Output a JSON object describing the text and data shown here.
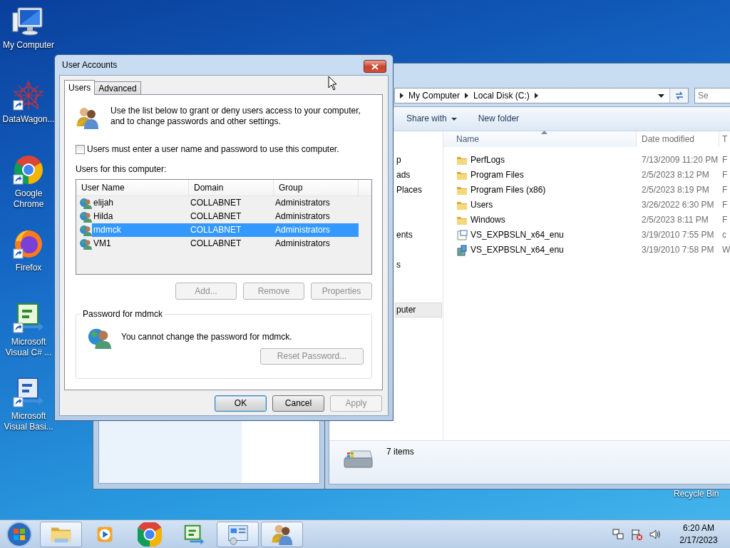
{
  "desktop": {
    "icons": [
      {
        "kind": "computer",
        "label": "My Computer",
        "shortcut": false
      },
      {
        "kind": "network-art",
        "label": "DataWagon...",
        "shortcut": true
      },
      {
        "kind": "browser",
        "label": "Google Chrome",
        "shortcut": true
      },
      {
        "kind": "firefox",
        "label": "Firefox",
        "shortcut": true
      },
      {
        "kind": "csharp",
        "label": "Microsoft Visual C# ...",
        "shortcut": true
      },
      {
        "kind": "vb",
        "label": "Microsoft Visual Basi...",
        "shortcut": true
      }
    ],
    "recycle_bin_label": "Recycle Bin"
  },
  "explorer": {
    "breadcrumb": [
      "My Computer",
      "Local Disk (C:)"
    ],
    "search": {
      "placeholder": "Se"
    },
    "toolbar": [
      {
        "label": "Share with",
        "dropdown": true
      },
      {
        "label": "New folder",
        "dropdown": false
      }
    ],
    "nav_items": [
      {
        "label": "p",
        "selected": false
      },
      {
        "label": "ads",
        "selected": false
      },
      {
        "label": "Places",
        "selected": false
      },
      {
        "label": "ents",
        "selected": false
      },
      {
        "label": "s",
        "selected": false
      },
      {
        "label": "puter",
        "selected": true
      }
    ],
    "columns": [
      {
        "label": "Name",
        "sorted": true
      },
      {
        "label": "Date modified",
        "sorted": false
      },
      {
        "label": "T",
        "sorted": false
      }
    ],
    "rows": [
      {
        "kind": "folder",
        "name": "PerfLogs",
        "date_modified": "7/13/2009 11:20 PM",
        "column_3": "F"
      },
      {
        "kind": "folder",
        "name": "Program Files",
        "date_modified": "2/5/2023 8:12 PM",
        "column_3": "F"
      },
      {
        "kind": "folder",
        "name": "Program Files (x86)",
        "date_modified": "2/5/2023 8:19 PM",
        "column_3": "F"
      },
      {
        "kind": "folder",
        "name": "Users",
        "date_modified": "3/26/2022 6:30 PM",
        "column_3": "F"
      },
      {
        "kind": "folder",
        "name": "Windows",
        "date_modified": "2/5/2023 8:11 PM",
        "column_3": "F"
      },
      {
        "kind": "setup",
        "name": "VS_EXPBSLN_x64_enu",
        "date_modified": "3/19/2010 7:55 PM",
        "column_3": "c"
      },
      {
        "kind": "installer",
        "name": "VS_EXPBSLN_x64_enu",
        "date_modified": "3/19/2010 7:58 PM",
        "column_3": "W"
      }
    ],
    "status": "7 items"
  },
  "dialog": {
    "title": "User Accounts",
    "tabs": [
      {
        "label": "Users",
        "selected": true
      },
      {
        "label": "Advanced",
        "selected": false
      }
    ],
    "intro": "Use the list below to grant or deny users access to your computer, and to change passwords and other settings.",
    "checkbox": {
      "label": "Users must enter a user name and password to use this computer.",
      "checked": false
    },
    "list_label": "Users for this computer:",
    "columns": [
      "User Name",
      "Domain",
      "Group"
    ],
    "users": [
      {
        "name": "elijah",
        "domain": "COLLABNET",
        "group": "Administrators",
        "selected": false
      },
      {
        "name": "Hilda",
        "domain": "COLLABNET",
        "group": "Administrators",
        "selected": false
      },
      {
        "name": "mdmck",
        "domain": "COLLABNET",
        "group": "Administrators",
        "selected": true
      },
      {
        "name": "VM1",
        "domain": "COLLABNET",
        "group": "Administrators",
        "selected": false
      }
    ],
    "list_buttons": [
      {
        "label": "Add...",
        "disabled": true
      },
      {
        "label": "Remove",
        "disabled": true
      },
      {
        "label": "Properties",
        "disabled": true
      }
    ],
    "password_group": {
      "title": "Password for mdmck",
      "message": "You cannot change the password for mdmck.",
      "button": {
        "label": "Reset Password...",
        "disabled": true
      }
    },
    "footer_buttons": [
      {
        "label": "OK",
        "disabled": false,
        "default": true
      },
      {
        "label": "Cancel",
        "disabled": false,
        "default": false
      },
      {
        "label": "Apply",
        "disabled": true,
        "default": false
      }
    ]
  },
  "taskbar": {
    "buttons": [
      {
        "kind": "explorer",
        "running": true
      },
      {
        "kind": "media",
        "running": false
      },
      {
        "kind": "browser",
        "running": false
      },
      {
        "kind": "csharp",
        "running": false
      },
      {
        "kind": "control-panel",
        "running": true
      },
      {
        "kind": "user-accounts",
        "running": true
      }
    ],
    "time": "6:20 AM",
    "date": "2/17/2023"
  }
}
